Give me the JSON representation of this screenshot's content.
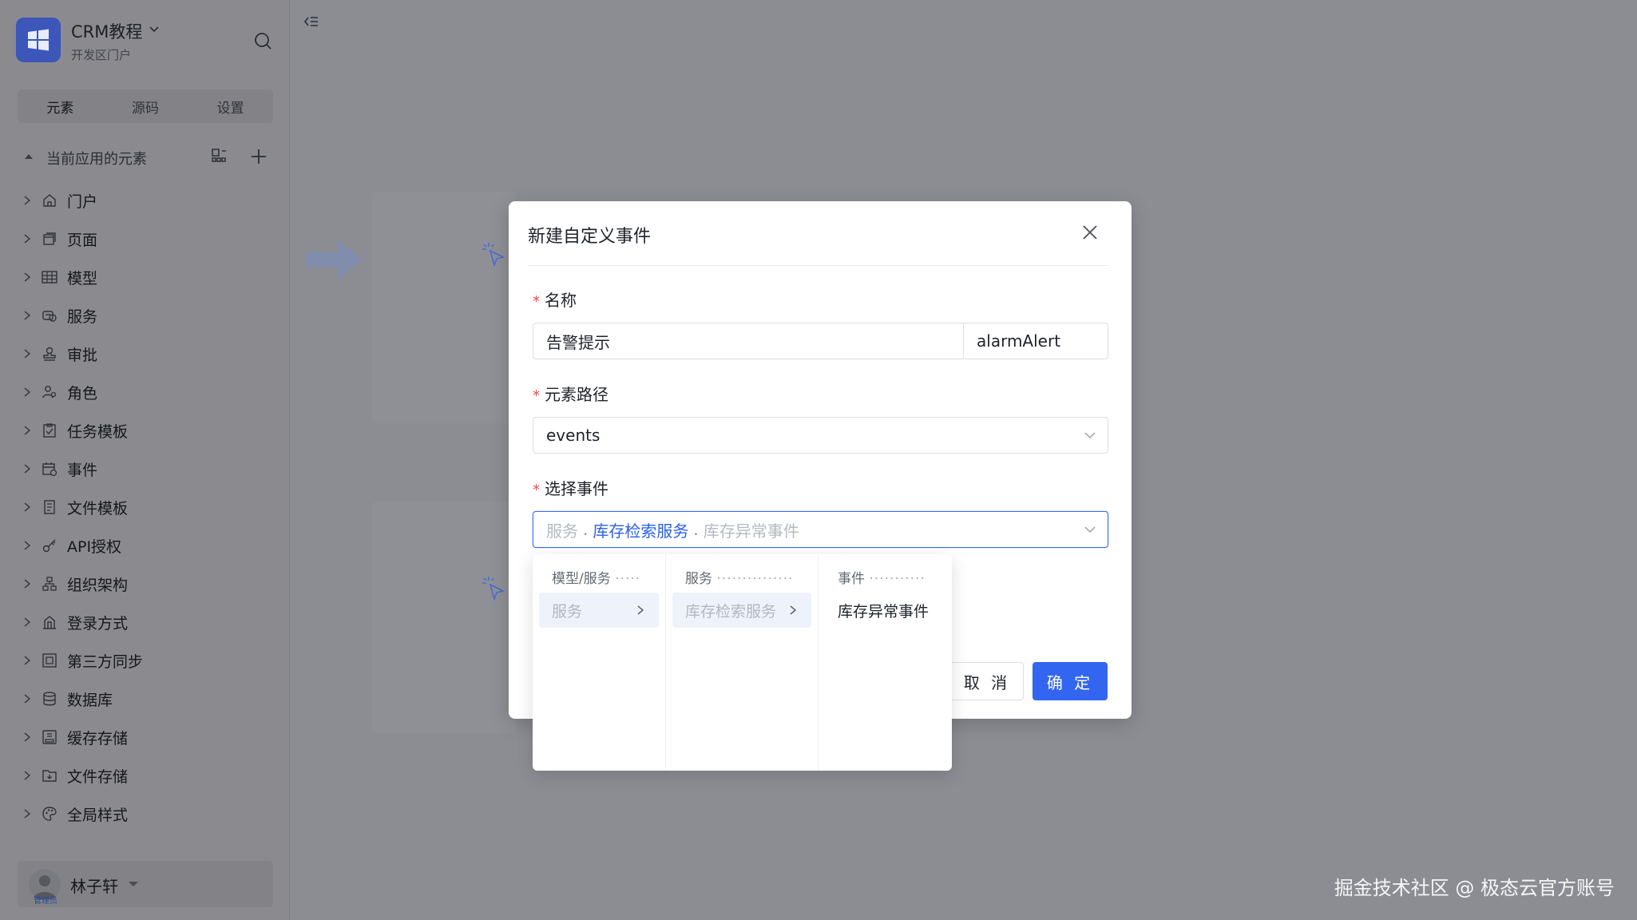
{
  "app": {
    "name": "CRM教程",
    "subtitle": "开发区门户"
  },
  "sidebar": {
    "tabs": [
      {
        "label": "元素"
      },
      {
        "label": "源码"
      },
      {
        "label": "设置"
      }
    ],
    "section_title": "当前应用的元素",
    "items": [
      {
        "label": "门户",
        "icon": "home-icon"
      },
      {
        "label": "页面",
        "icon": "page-icon"
      },
      {
        "label": "模型",
        "icon": "table-icon"
      },
      {
        "label": "服务",
        "icon": "service-icon"
      },
      {
        "label": "审批",
        "icon": "stamp-icon"
      },
      {
        "label": "角色",
        "icon": "users-icon"
      },
      {
        "label": "任务模板",
        "icon": "task-icon"
      },
      {
        "label": "事件",
        "icon": "event-icon"
      },
      {
        "label": "文件模板",
        "icon": "file-template-icon"
      },
      {
        "label": "API授权",
        "icon": "key-icon"
      },
      {
        "label": "组织架构",
        "icon": "org-icon"
      },
      {
        "label": "登录方式",
        "icon": "login-icon"
      },
      {
        "label": "第三方同步",
        "icon": "sync-icon"
      },
      {
        "label": "数据库",
        "icon": "database-icon"
      },
      {
        "label": "缓存存储",
        "icon": "cache-icon"
      },
      {
        "label": "文件存储",
        "icon": "folder-icon"
      },
      {
        "label": "全局样式",
        "icon": "palette-icon"
      }
    ],
    "user": {
      "name": "林子轩",
      "badge": "管理员"
    }
  },
  "modal": {
    "title": "新建自定义事件",
    "name_label": "名称",
    "name_value": "告警提示",
    "code_value": "alarmAlert",
    "path_label": "元素路径",
    "path_value": "events",
    "event_label": "选择事件",
    "event_path": {
      "part1": "服务",
      "part2": "库存检索服务",
      "part3": "库存异常事件"
    },
    "cancel_label": "取 消",
    "ok_label": "确 定"
  },
  "cascader": {
    "columns": [
      {
        "header": "模型/服务",
        "option": "服务"
      },
      {
        "header": "服务",
        "option": "库存检索服务"
      },
      {
        "header": "事件",
        "option": "库存异常事件"
      }
    ]
  },
  "watermark": "掘金技术社区 @ 极态云官方账号",
  "colors": {
    "primary": "#3366f0",
    "overlay": "#8b8d93",
    "required": "#f5484a"
  }
}
